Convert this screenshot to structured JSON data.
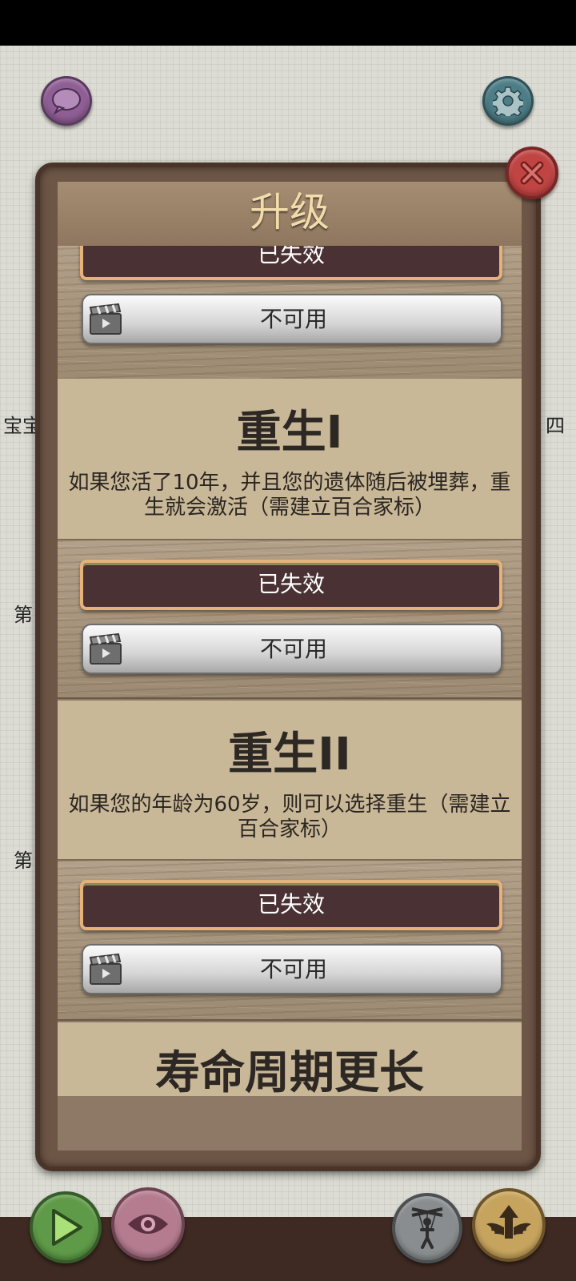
{
  "modal": {
    "title": "升级",
    "top_partial_status": "已失效",
    "top_partial_video": "不可用"
  },
  "upgrades": [
    {
      "title": "重生I",
      "description": "如果您活了10年，并且您的遗体随后被埋葬，重生就会激活（需建立百合家标）",
      "status": "已失效",
      "video_label": "不可用"
    },
    {
      "title": "重生II",
      "description": "如果您的年龄为60岁，则可以选择重生（需建立百合家标）",
      "status": "已失效",
      "video_label": "不可用"
    },
    {
      "title": "寿命周期更长"
    }
  ],
  "background_text": {
    "left_1": "宝宝",
    "right_1": "四",
    "left_2": "第",
    "left_3": "第"
  },
  "icons": {
    "chat": "chat-bubble-icon",
    "settings": "gear-icon",
    "close": "close-icon",
    "video": "clapperboard-icon",
    "play": "play-icon",
    "eye": "eye-icon",
    "puppet": "puppet-icon",
    "upgrade": "winged-arrow-icon"
  },
  "colors": {
    "modal_frame": "#4a3428",
    "status_button": "#4a3133",
    "close_button": "#c04442"
  }
}
